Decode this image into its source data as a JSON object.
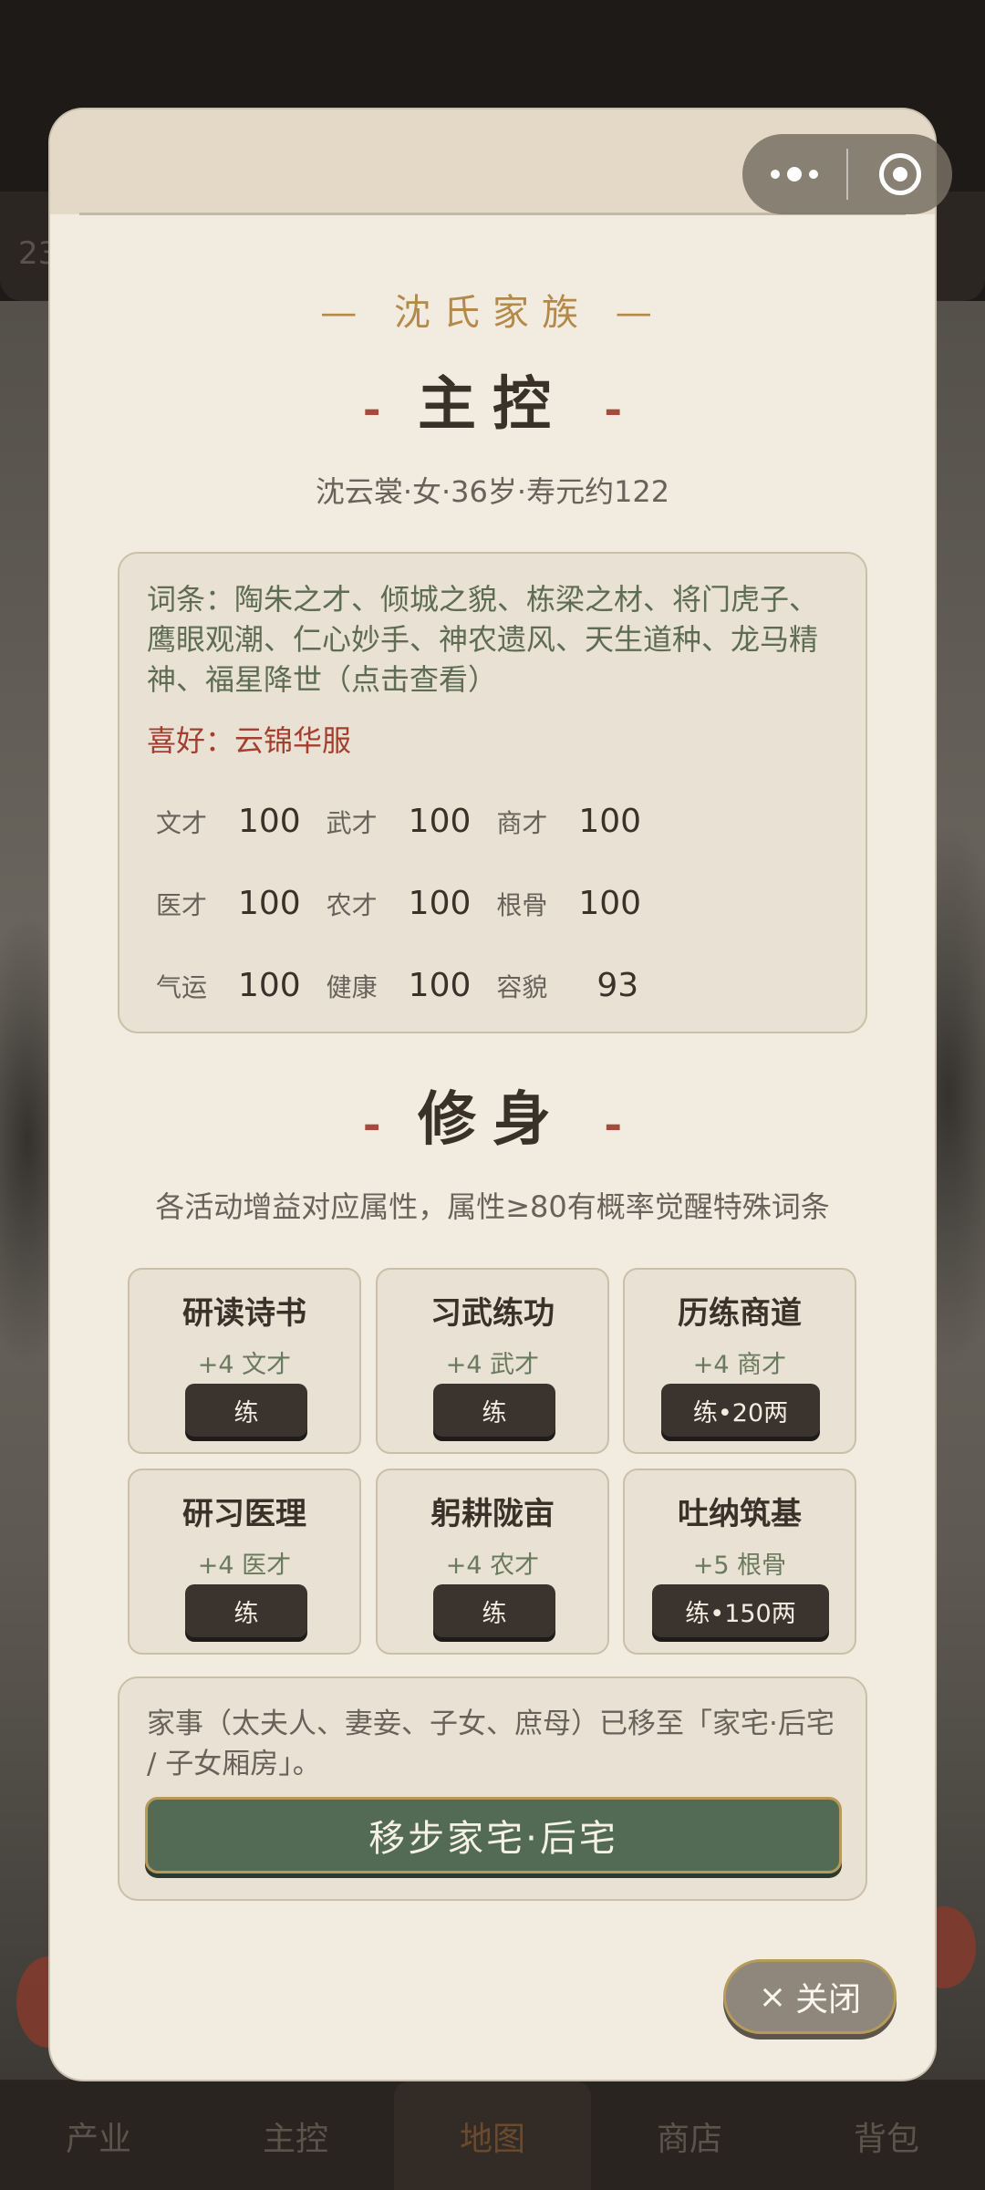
{
  "background": {
    "header_number": "23"
  },
  "bottom_nav": {
    "items": [
      {
        "label": "产业"
      },
      {
        "label": "主控"
      },
      {
        "label": "地图"
      },
      {
        "label": "商店"
      },
      {
        "label": "背包"
      }
    ],
    "active": "地图"
  },
  "capsule": {
    "more_icon": "more-dots-icon",
    "close_icon": "target-icon"
  },
  "modal": {
    "family_title": "沈氏家族",
    "family_dash_left": "—",
    "family_dash_right": "—",
    "section_mark": "-",
    "main": {
      "title": "主控",
      "subtitle": "沈云裳·女·36岁·寿元约122",
      "traits": "词条：陶朱之才、倾城之貌、栋梁之材、将门虎子、鹰眼观潮、仁心妙手、神农遗风、天生道种、龙马精神、福星降世（点击查看）",
      "hobby": "喜好：云锦华服",
      "stats": [
        {
          "label": "文才",
          "value": "100"
        },
        {
          "label": "武才",
          "value": "100"
        },
        {
          "label": "商才",
          "value": "100"
        },
        {
          "label": "医才",
          "value": "100"
        },
        {
          "label": "农才",
          "value": "100"
        },
        {
          "label": "根骨",
          "value": "100"
        },
        {
          "label": "气运",
          "value": "100"
        },
        {
          "label": "健康",
          "value": "100"
        },
        {
          "label": "容貌",
          "value": "93"
        }
      ]
    },
    "training": {
      "title": "修身",
      "subtitle": "各活动增益对应属性，属性≥80有概率觉醒特殊词条",
      "items": [
        {
          "name": "研读诗书",
          "gain": "+4 文才",
          "button": "练"
        },
        {
          "name": "习武练功",
          "gain": "+4 武才",
          "button": "练"
        },
        {
          "name": "历练商道",
          "gain": "+4 商才",
          "button": "练•20两"
        },
        {
          "name": "研习医理",
          "gain": "+4 医才",
          "button": "练"
        },
        {
          "name": "躬耕陇亩",
          "gain": "+4 农才",
          "button": "练"
        },
        {
          "name": "吐纳筑基",
          "gain": "+5 根骨",
          "button": "练•150两"
        }
      ]
    },
    "notice": {
      "text": "家事（太夫人、妻妾、子女、庶母）已移至「家宅·后宅 / 子女厢房」。",
      "button": "移步家宅·后宅"
    },
    "close": {
      "icon": "×",
      "label": "关闭"
    }
  }
}
